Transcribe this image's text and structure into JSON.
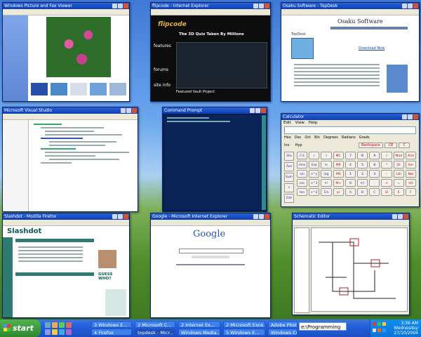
{
  "windows": {
    "photo_viewer": {
      "title": "Windows Picture and Fax Viewer"
    },
    "flipcode": {
      "title": "flipcode - Internet Explorer",
      "headline": "The 3D Quiz Taken By Millions",
      "logo": "flipcode",
      "nav": [
        "features",
        "forums",
        "site info"
      ],
      "bottom": "Featured Vault Project"
    },
    "osaku": {
      "title": "Osaku Software - TopDesk",
      "brand": "Osaku Software",
      "product": "TopDesk",
      "download": "Download Now"
    },
    "editor": {
      "title": "Microsoft Visual Studio"
    },
    "console": {
      "title": "Command Prompt"
    },
    "calculator": {
      "title": "Calculator",
      "menu": [
        "Edit",
        "View",
        "Help"
      ],
      "modes": [
        "Hex",
        "Dec",
        "Oct",
        "Bin",
        "Degrees",
        "Radians",
        "Grads"
      ],
      "checks": [
        "Inv",
        "Hyp"
      ],
      "top_buttons": [
        "Backspace",
        "CE",
        "C"
      ],
      "left_column": [
        "Sta",
        "Ave",
        "Sum",
        "s",
        "Dat"
      ],
      "row1": [
        "F-E",
        "(",
        ")",
        "MC",
        "7",
        "8",
        "9",
        "/",
        "Mod",
        "And"
      ],
      "row2": [
        "dms",
        "Exp",
        "ln",
        "MR",
        "4",
        "5",
        "6",
        "*",
        "Or",
        "Xor"
      ],
      "row3": [
        "sin",
        "x^y",
        "log",
        "MS",
        "1",
        "2",
        "3",
        "-",
        "Lsh",
        "Not"
      ],
      "row4": [
        "cos",
        "x^3",
        "n!",
        "M+",
        "0",
        "+/-",
        ".",
        "+",
        "=",
        "Int"
      ],
      "row5": [
        "tan",
        "x^2",
        "1/x",
        "pi",
        "A",
        "B",
        "C",
        "D",
        "E",
        "F"
      ]
    },
    "slashdot": {
      "title": "Slashdot - Mozilla Firefox",
      "logo": "Slashdot",
      "guess": "GUESS WHO?"
    },
    "google": {
      "title": "Google - Microsoft Internet Explorer",
      "logo": "Google"
    },
    "circuit": {
      "title": "Schematic Editor"
    }
  },
  "taskbar": {
    "start": "start",
    "buttons": [
      "3 Windows E...",
      "2 Microsoft C...",
      "2 Internet Ex...",
      "2 Microsoft Exce...",
      "Adobe Photoshop",
      "4 Firefox",
      "topdesk - Micr...",
      "Windows Media...",
      "5 Windows E...",
      "Windows Com..."
    ],
    "address": "e:\\Programming",
    "clock": {
      "time": "3:36 AM",
      "day": "Wednesday",
      "date": "27/10/2004"
    }
  }
}
